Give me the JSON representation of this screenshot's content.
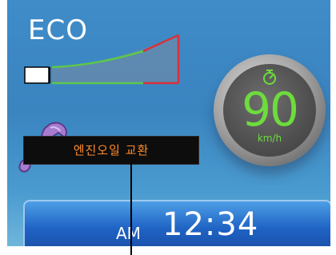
{
  "eco": {
    "label": "ECO",
    "level": 0.12
  },
  "speed": {
    "value": "90",
    "unit": "km/h",
    "icon": "cruise-control-icon"
  },
  "alert": {
    "icon": "wrench-icon",
    "message": "엔진오일 교환"
  },
  "clock": {
    "ampm": "AM",
    "time": "12:34"
  },
  "colors": {
    "background": "#3f8cc8",
    "speed_digits": "#6ddc3c",
    "alert_text": "#ff8a2a",
    "eco_low": "#ffffff",
    "eco_mid": "#5cc84a",
    "eco_high": "#d8313a"
  }
}
